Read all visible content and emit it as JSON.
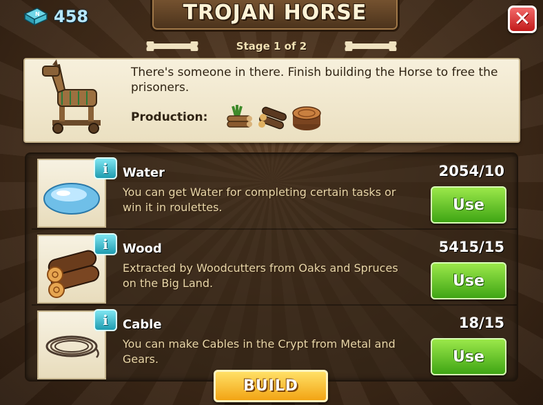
{
  "currency": {
    "amount": "458",
    "icon": "book-gem-icon"
  },
  "title": "TROJAN HORSE",
  "stage": "Stage 1 of 2",
  "info": {
    "description": "There's someone in there. Finish building the Horse to free the prisoners.",
    "production_label": "Production:",
    "production_icons": [
      "log-bundle-icon",
      "logs-icon",
      "tree-stump-icon"
    ]
  },
  "resources": [
    {
      "name": "Water",
      "description": "You can get Water for completing certain tasks or win it in roulettes.",
      "count": "2054/10",
      "button": "Use",
      "icon": "water-drop-icon"
    },
    {
      "name": "Wood",
      "description": "Extracted by Woodcutters from Oaks and Spruces on the Big Land.",
      "count": "5415/15",
      "button": "Use",
      "icon": "wood-logs-icon"
    },
    {
      "name": "Cable",
      "description": "You can make Cables in the Crypt from Metal and Gears.",
      "count": "18/15",
      "button": "Use",
      "icon": "cable-coil-icon"
    }
  ],
  "build_button": "BUILD",
  "info_glyph": "i",
  "close_glyph": "✕",
  "colors": {
    "use_button": "#3fa514",
    "build_button": "#f2a414",
    "close_button": "#c21a1a",
    "info_button": "#1f9cb0"
  }
}
